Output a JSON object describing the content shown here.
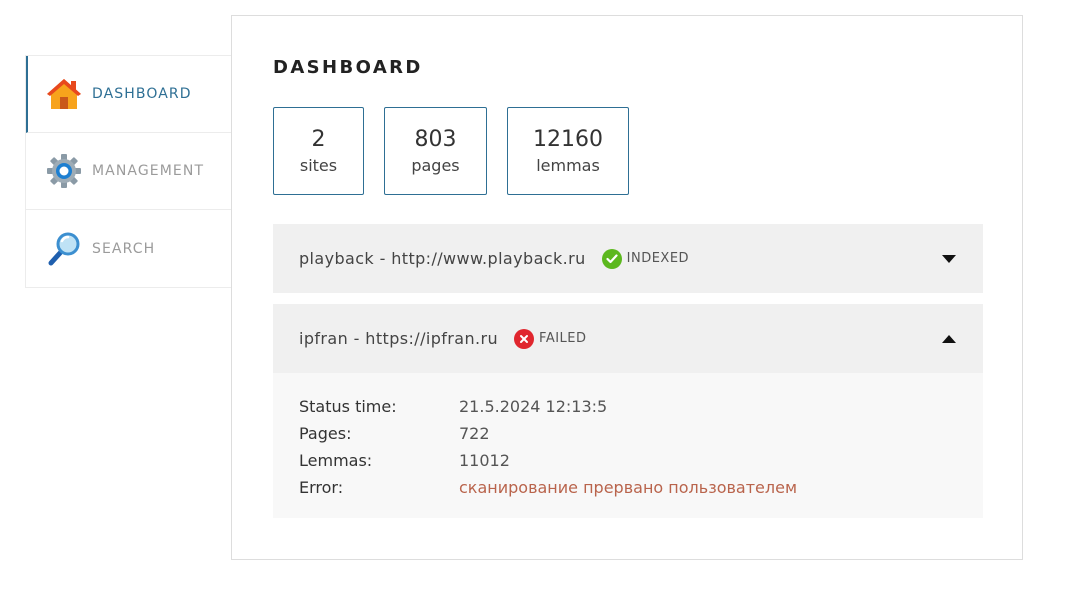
{
  "sidebar": {
    "items": [
      {
        "label": "DASHBOARD",
        "icon": "home-icon",
        "active": true
      },
      {
        "label": "MANAGEMENT",
        "icon": "gear-icon",
        "active": false
      },
      {
        "label": "SEARCH",
        "icon": "magnifier-icon",
        "active": false
      }
    ]
  },
  "main": {
    "title": "DASHBOARD",
    "stats": [
      {
        "value": "2",
        "label": "sites"
      },
      {
        "value": "803",
        "label": "pages"
      },
      {
        "value": "12160",
        "label": "lemmas"
      }
    ],
    "sites": [
      {
        "title": "playback - http://www.playback.ru",
        "status": "INDEXED",
        "status_icon": "check-icon",
        "status_color": "#5cb81e",
        "expanded": false
      },
      {
        "title": "ipfran - https://ipfran.ru",
        "status": "FAILED",
        "status_icon": "error-x-icon",
        "status_color": "#e0262e",
        "expanded": true,
        "details": [
          {
            "key": "Status time:",
            "value": "21.5.2024 12:13:5"
          },
          {
            "key": "Pages:",
            "value": "722"
          },
          {
            "key": "Lemmas:",
            "value": "11012"
          },
          {
            "key": "Error:",
            "value": "сканирование прервано пользователем"
          }
        ]
      }
    ]
  },
  "colors": {
    "accent": "#2e6f94",
    "error_text": "#b9644c"
  }
}
